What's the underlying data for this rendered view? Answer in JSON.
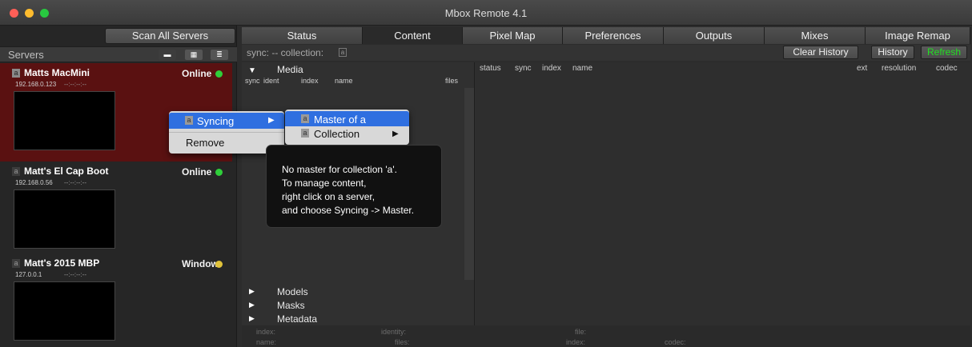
{
  "window": {
    "title": "Mbox Remote 4.1"
  },
  "left": {
    "scan_button": "Scan All Servers",
    "servers_label": "Servers",
    "view_icons": [
      "list-compact-icon",
      "grid-icon",
      "list-icon"
    ],
    "servers": [
      {
        "badge": "a",
        "name": "Matts MacMini",
        "ip": "192.168.0.123",
        "time": "--:--:--:--",
        "status": "Online",
        "status_color": "#2fcf3a"
      },
      {
        "badge": "a",
        "name": "Matt's El Cap Boot",
        "ip": "192.168.0.56",
        "time": "--:--:--:--",
        "status": "Online",
        "status_color": "#2fcf3a"
      },
      {
        "badge": "a",
        "name": "Matt's 2015 MBP",
        "ip": "127.0.0.1",
        "time": "--:--:--:--",
        "status": "Window",
        "status_color": "#e0c23a"
      }
    ]
  },
  "tabs": [
    "Status",
    "Content",
    "Pixel Map",
    "Preferences",
    "Outputs",
    "Mixes",
    "Image Remap"
  ],
  "active_tab": "Content",
  "syncbar": {
    "text": "sync: -- collection:",
    "collection_badge": "a",
    "clear_history": "Clear History",
    "history": "History",
    "refresh": "Refresh",
    "refresh_color": "#21e021"
  },
  "media": {
    "title": "Media",
    "columns": [
      "sync",
      "ident",
      "index",
      "name",
      "files"
    ],
    "sections": [
      "Models",
      "Masks",
      "Metadata"
    ],
    "info": {
      "index": "index:",
      "identity": "identity:",
      "file": "file:",
      "name": "name:",
      "files": "files:",
      "index2": "index:",
      "codec": "codec:"
    }
  },
  "content": {
    "columns": [
      "status",
      "sync",
      "index",
      "name",
      "ext",
      "resolution",
      "codec"
    ]
  },
  "context_menu": {
    "syncing_badge": "a",
    "syncing": "Syncing",
    "remove": "Remove",
    "submenu": [
      {
        "badge": "a",
        "label": "Master of a",
        "selected": true
      },
      {
        "badge": "a",
        "label": "Collection",
        "has_submenu": true
      }
    ],
    "highlight_color": "#2f6fe0"
  },
  "tooltip": {
    "lines": [
      "No master for collection 'a'.",
      "To manage content,",
      "right click on a server,",
      "and choose Syncing -> Master."
    ]
  }
}
